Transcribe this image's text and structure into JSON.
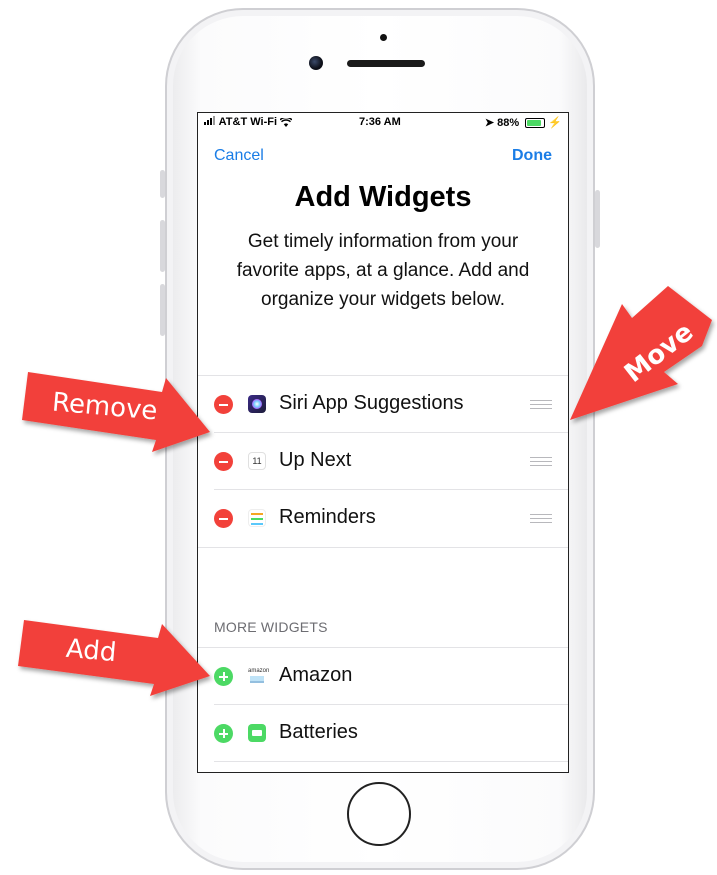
{
  "status_bar": {
    "carrier": "AT&T Wi-Fi",
    "time": "7:36 AM",
    "battery": "88%",
    "battery_level": 0.88
  },
  "nav": {
    "cancel_label": "Cancel",
    "done_label": "Done"
  },
  "page": {
    "title": "Add Widgets",
    "subtitle": "Get timely information from your favorite apps, at a glance. Add and organize your widgets below."
  },
  "active_widgets": [
    {
      "label": "Siri App Suggestions",
      "icon": "siri-icon"
    },
    {
      "label": "Up Next",
      "icon": "calendar-icon",
      "icon_text": "11"
    },
    {
      "label": "Reminders",
      "icon": "reminders-icon"
    }
  ],
  "more_widgets": {
    "header": "MORE WIDGETS",
    "items": [
      {
        "label": "Amazon",
        "icon": "amazon-icon",
        "icon_text": "amazon"
      },
      {
        "label": "Batteries",
        "icon": "batteries-icon"
      }
    ]
  },
  "annotations": {
    "remove": "Remove",
    "move": "Move",
    "add": "Add",
    "arrow_color": "#f2413a"
  }
}
